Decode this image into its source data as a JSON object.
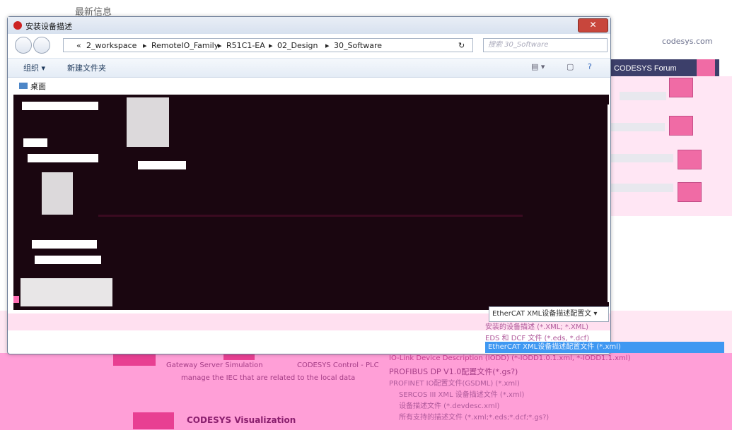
{
  "page": {
    "latest_title": "最新信息"
  },
  "codesys": {
    "site": "codesys.com",
    "forum_label": "CODESYS Forum",
    "forum_icon": "chat-icon"
  },
  "dialog": {
    "title": "安装设备描述",
    "close_symbol": "✕",
    "back_icon": "back-arrow-icon",
    "forward_icon": "forward-arrow-icon",
    "breadcrumbs": [
      "«",
      "2_workspace",
      "▸",
      "RemoteIO_Family",
      "▸",
      "R51C1-EA",
      "▸",
      "02_Design",
      "▸",
      "30_Software"
    ],
    "search_placeholder": "搜索 30_Software",
    "refresh_symbol": "↻",
    "toolbar": {
      "organize": "组织 ▾",
      "new_folder": "新建文件夹"
    },
    "desktop_label": "桌面",
    "filetype_selected": "EtherCAT XML设备描述配置文 ▾"
  },
  "dropdown": {
    "items": [
      "安装的设备描述 (*.XML; *.XML)",
      "EDS 和 DCF 文件 (*.eds, *.dcf)",
      "IO-Link Device Description (IODD) (*-IODD1.0.1.xml, *-IODD1.1.xml)",
      "PROFIBUS DP V1.0配置文件(*.gs?)",
      "PROFINET IO配置文件(GSDML) (*.xml)",
      "SERCOS III XML 设备描述文件 (*.xml)",
      "设备描述文件 (*.devdesc.xml)",
      "所有支持的描述文件 (*.xml;*.eds;*.dcf;*.gs?)"
    ],
    "selected_text": "EtherCAT XML设备描述配置文件 (*.xml)"
  },
  "bottom": {
    "gateway_text": "Gateway Server Simulation",
    "codesys_control": "CODESYS Control - PLC",
    "manage_text": "manage the IEC that are related to the local data",
    "visualization": "CODESYS Visualization"
  }
}
